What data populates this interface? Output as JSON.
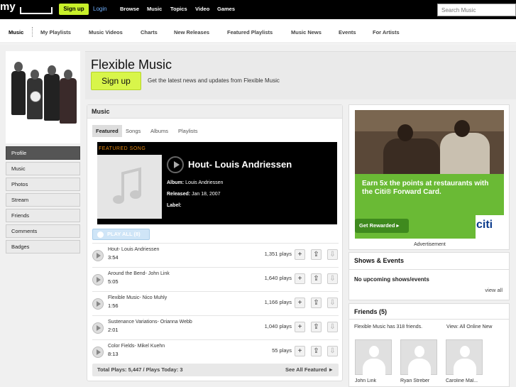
{
  "header": {
    "logo_text": "my",
    "signup_label": "Sign up",
    "login_label": "Login",
    "nav": [
      "Browse",
      "Music",
      "Topics",
      "Video",
      "Games"
    ],
    "search_placeholder": "Search Music"
  },
  "subnav": [
    "Music",
    "My Playlists",
    "Music Videos",
    "Charts",
    "New Releases",
    "Featured Playlists",
    "Music News",
    "Events",
    "For Artists"
  ],
  "profile_nav": [
    "Profile",
    "Music",
    "Photos",
    "Stream",
    "Friends",
    "Comments",
    "Badges"
  ],
  "banner": {
    "title": "Flexible Music",
    "signup_label": "Sign up",
    "subtitle": "Get the latest news and updates from Flexible Music"
  },
  "music": {
    "heading": "Music",
    "tabs": [
      "Featured",
      "Songs",
      "Albums",
      "Playlists"
    ],
    "featured": {
      "label": "FEATURED SONG",
      "title": "Hout- Louis Andriessen",
      "album_label": "Album:",
      "album": "Louis Andriessen",
      "released_label": "Released:",
      "released": "Jan 18, 2007",
      "label_label": "Label:",
      "label_value": ""
    },
    "play_all": "PLAY ALL (8)",
    "tracks": [
      {
        "name": "Hout- Louis Andriessen",
        "duration": "3:54",
        "plays": "1,351 plays"
      },
      {
        "name": "Around the Bend- John Link",
        "duration": "5:05",
        "plays": "1,640 plays"
      },
      {
        "name": "Flexible Music- Nico Muhly",
        "duration": "1:56",
        "plays": "1,166 plays"
      },
      {
        "name": "Sustenance Variations- Orianna Webb",
        "duration": "2:01",
        "plays": "1,040 plays"
      },
      {
        "name": "Color Fields- Mikel Kuehn",
        "duration": "8:13",
        "plays": "55 plays"
      }
    ],
    "totals": "Total Plays: 5,447 / Plays Today: 3",
    "see_all": "See All Featured ►"
  },
  "ad": {
    "headline": "Earn 5x the points at restaurants with the Citi® Forward Card.",
    "button": "Get Rewarded ▸",
    "brand": "citi",
    "label": "Advertisement"
  },
  "shows": {
    "heading": "Shows & Events",
    "empty": "No upcoming shows/events",
    "view_all": "view all"
  },
  "friends": {
    "heading": "Friends (5)",
    "count_text": "Flexible Music has 318 friends.",
    "view_text": "View:  All  Online  New",
    "people": [
      "John Link",
      "Ryan Streber",
      "Caroline Mal..."
    ]
  }
}
